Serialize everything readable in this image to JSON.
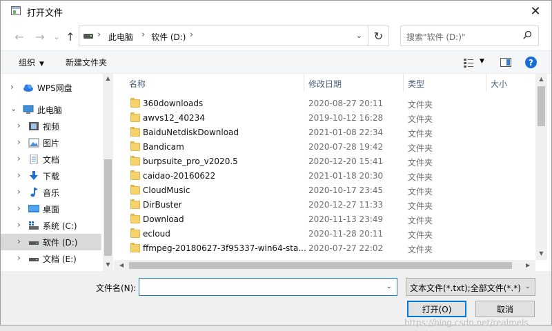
{
  "window": {
    "title": "打开文件",
    "close_glyph": "✕"
  },
  "navigation": {
    "back_glyph": "←",
    "forward_glyph": "→",
    "recent_glyph": "⌄",
    "up_glyph": "↑",
    "breadcrumb": [
      "此电脑",
      "软件 (D:)"
    ],
    "breadcrumb_sep": "›",
    "dropdown_glyph": "⌄",
    "refresh_glyph": "↻",
    "search_placeholder": "搜索\"软件 (D:)\""
  },
  "toolbar": {
    "organize_label": "组织",
    "new_folder_label": "新建文件夹",
    "caret_glyph": "▼",
    "help_glyph": "?"
  },
  "sidebar": {
    "items": [
      {
        "label": "WPS网盘",
        "icon": "cloud-icon",
        "chevron": "›"
      },
      {
        "label": "此电脑",
        "icon": "computer-icon",
        "chevron": "⌄"
      },
      {
        "label": "视频",
        "icon": "video-icon",
        "chevron": "›"
      },
      {
        "label": "图片",
        "icon": "picture-icon",
        "chevron": "›"
      },
      {
        "label": "文档",
        "icon": "document-icon",
        "chevron": "›"
      },
      {
        "label": "下载",
        "icon": "download-icon",
        "chevron": "›"
      },
      {
        "label": "音乐",
        "icon": "music-icon",
        "chevron": "›"
      },
      {
        "label": "桌面",
        "icon": "desktop-icon",
        "chevron": "›"
      },
      {
        "label": "系统 (C:)",
        "icon": "system-drive-icon",
        "chevron": "›"
      },
      {
        "label": "软件 (D:)",
        "icon": "drive-icon",
        "chevron": "›",
        "selected": true
      },
      {
        "label": "文档 (E:)",
        "icon": "drive-icon",
        "chevron": "›"
      }
    ]
  },
  "file_list": {
    "columns": {
      "name": "名称",
      "modified": "修改日期",
      "type": "类型",
      "size": "大小",
      "sort_glyph": "^"
    },
    "rows": [
      {
        "name": "360downloads",
        "modified": "2020-08-27 20:11",
        "type": "文件夹"
      },
      {
        "name": "awvs12_40234",
        "modified": "2019-10-12 16:28",
        "type": "文件夹"
      },
      {
        "name": "BaiduNetdiskDownload",
        "modified": "2021-01-08 22:34",
        "type": "文件夹"
      },
      {
        "name": "Bandicam",
        "modified": "2020-07-28 19:42",
        "type": "文件夹"
      },
      {
        "name": "burpsuite_pro_v2020.5",
        "modified": "2020-12-20 15:41",
        "type": "文件夹"
      },
      {
        "name": "caidao-20160622",
        "modified": "2021-01-18 20:30",
        "type": "文件夹"
      },
      {
        "name": "CloudMusic",
        "modified": "2020-10-17 23:45",
        "type": "文件夹"
      },
      {
        "name": "DirBuster",
        "modified": "2020-12-27 11:33",
        "type": "文件夹"
      },
      {
        "name": "Download",
        "modified": "2020-11-13 23:49",
        "type": "文件夹"
      },
      {
        "name": "ecloud",
        "modified": "2020-11-28 20:11",
        "type": "文件夹"
      },
      {
        "name": "ffmpeg-20180627-3f95337-win64-sta...",
        "modified": "2020-07-27 22:02",
        "type": "文件夹"
      }
    ]
  },
  "footer": {
    "filename_label": "文件名(N):",
    "filename_value": "",
    "filter_value": "文本文件(*.txt);全部文件(*.*)",
    "dropdown_glyph": "⌄",
    "open_button": "打开(O)",
    "cancel_button": "取消"
  },
  "watermark": "https://blog.csdn.net/realmels",
  "colors": {
    "accent": "#0078d7",
    "folder": "#f6d26b",
    "selected_bg": "#d9d9d9"
  }
}
